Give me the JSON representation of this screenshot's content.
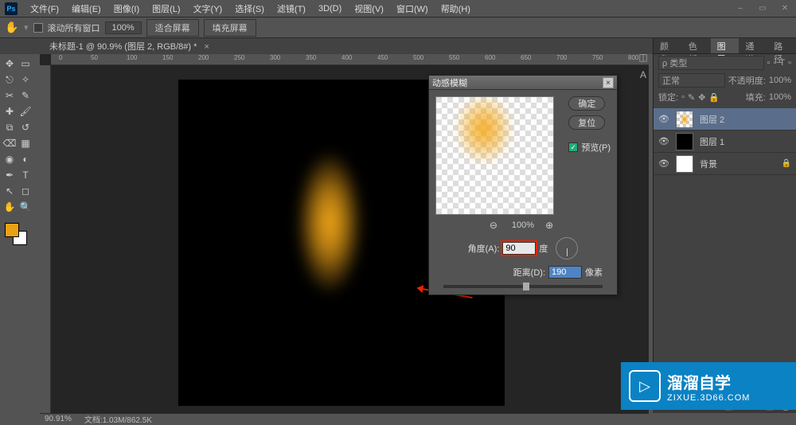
{
  "app": {
    "logo": "Ps"
  },
  "menu": [
    "文件(F)",
    "编辑(E)",
    "图像(I)",
    "图层(L)",
    "文字(Y)",
    "选择(S)",
    "滤镜(T)",
    "3D(D)",
    "视图(V)",
    "窗口(W)",
    "帮助(H)"
  ],
  "window_controls": {
    "min": "–",
    "restore": "▭",
    "close": "✕"
  },
  "options": {
    "scroll_label": "滚动所有窗口",
    "zoom_value": "100%",
    "fit_label": "适合屏幕",
    "fill_label": "填充屏幕"
  },
  "tab": {
    "title": "未标题-1 @ 90.9% (图层 2, RGB/8#) *",
    "close": "×"
  },
  "ruler_ticks": [
    "0",
    "50",
    "100",
    "150",
    "200",
    "250",
    "300",
    "350",
    "400",
    "450",
    "500",
    "550",
    "600",
    "650",
    "700",
    "750",
    "800"
  ],
  "dialog": {
    "title": "动感模糊",
    "ok": "确定",
    "reset": "复位",
    "preview_label": "预览(P)",
    "zoom_value": "100%",
    "angle_label": "角度(A):",
    "angle_value": "90",
    "angle_unit": "度",
    "distance_label": "距离(D):",
    "distance_value": "190",
    "distance_unit": "像素",
    "close": "×"
  },
  "panels": {
    "top_tabs": [
      "颜色",
      "色板",
      "图层",
      "通道",
      "路径"
    ],
    "type_label": "ρ 类型",
    "blend_mode": "正常",
    "opacity_label": "不透明度:",
    "opacity_value": "100%",
    "lock_label": "锁定:",
    "fill_label": "填充:",
    "fill_value": "100%",
    "layers": [
      {
        "name": "图层 2",
        "thumb": "checker",
        "selected": true
      },
      {
        "name": "图层 1",
        "thumb": "black",
        "selected": false
      },
      {
        "name": "背景",
        "thumb": "white",
        "selected": false,
        "locked": true
      }
    ]
  },
  "status": {
    "zoom": "90.91%",
    "doc": "文档:1.03M/862.5K"
  },
  "watermark": {
    "brand": "溜溜自学",
    "url": "ZIXUE.3D66.COM"
  }
}
